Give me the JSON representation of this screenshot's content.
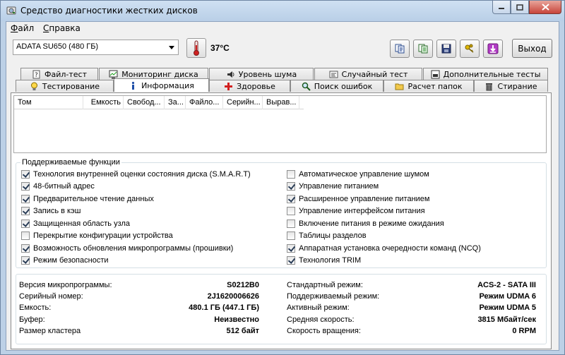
{
  "window": {
    "title": "Средство диагностики жестких дисков"
  },
  "menu": {
    "file_u": "Ф",
    "file_rest": "айл",
    "help_u": "С",
    "help_rest": "правка"
  },
  "toolbar": {
    "drive": "ADATA SU650 (480 ГБ)",
    "temperature": "37°C",
    "exit_label": "Выход"
  },
  "tabs_top": [
    {
      "label": "Файл-тест",
      "icon": "question-file-icon"
    },
    {
      "label": "Мониторинг диска",
      "icon": "monitor-chart-icon"
    },
    {
      "label": "Уровень шума",
      "icon": "speaker-icon"
    },
    {
      "label": "Случайный тест",
      "icon": "random-test-icon"
    },
    {
      "label": "Дополнительные тесты",
      "icon": "extra-tests-icon"
    }
  ],
  "tabs_bottom": [
    {
      "label": "Тестирование",
      "icon": "bulb-icon"
    },
    {
      "label": "Информация",
      "icon": "info-icon"
    },
    {
      "label": "Здоровье",
      "icon": "health-cross-icon"
    },
    {
      "label": "Поиск ошибок",
      "icon": "magnifier-icon"
    },
    {
      "label": "Расчет папок",
      "icon": "folder-icon"
    },
    {
      "label": "Стирание",
      "icon": "trash-icon"
    }
  ],
  "volumes_table": {
    "columns": [
      "Том",
      "Емкость",
      "Свобод...",
      "За...",
      "Файло...",
      "Серийн...",
      "Вырав..."
    ],
    "rows": []
  },
  "features": {
    "title": "Поддерживаемые функции",
    "left": [
      {
        "label": "Технология внутренней оценки состояния диска (S.M.A.R.T)",
        "checked": true
      },
      {
        "label": "48-битный адрес",
        "checked": true
      },
      {
        "label": "Предварительное чтение данных",
        "checked": true
      },
      {
        "label": "Запись в кэш",
        "checked": true
      },
      {
        "label": "Защищенная область узла",
        "checked": true
      },
      {
        "label": "Перекрытие конфигурации устройства",
        "checked": false
      },
      {
        "label": "Возможность обновления микропрограммы (прошивки)",
        "checked": true
      },
      {
        "label": "Режим безопасности",
        "checked": true
      }
    ],
    "right": [
      {
        "label": "Автоматическое управление шумом",
        "checked": false
      },
      {
        "label": "Управление питанием",
        "checked": true
      },
      {
        "label": "Расширенное управление питанием",
        "checked": true
      },
      {
        "label": "Управление интерфейсом питания",
        "checked": false
      },
      {
        "label": "Включение питания в режиме ожидания",
        "checked": false
      },
      {
        "label": "Таблицы разделов",
        "checked": false
      },
      {
        "label": "Аппаратная установка очередности команд (NCQ)",
        "checked": true
      },
      {
        "label": "Технология TRIM",
        "checked": true
      }
    ]
  },
  "info": {
    "left": [
      {
        "label": "Версия микропрограммы:",
        "value": "S0212B0"
      },
      {
        "label": "Серийный номер:",
        "value": "2J1620006626"
      },
      {
        "label": "Емкость:",
        "value": "480.1 ГБ (447.1 ГБ)"
      },
      {
        "label": "Буфер:",
        "value": "Неизвестно"
      },
      {
        "label": "Размер кластера",
        "value": "512 байт"
      }
    ],
    "right": [
      {
        "label": "Стандартный режим:",
        "value": "ACS-2 - SATA III"
      },
      {
        "label": "Поддерживаемый режим:",
        "value": "Режим UDMA 6"
      },
      {
        "label": "Активный режим:",
        "value": "Режим UDMA 5"
      },
      {
        "label": "Средняя скорость:",
        "value": "3815 Мбайт/сек"
      },
      {
        "label": "Скорость вращения:",
        "value": "0 RPM"
      }
    ]
  }
}
